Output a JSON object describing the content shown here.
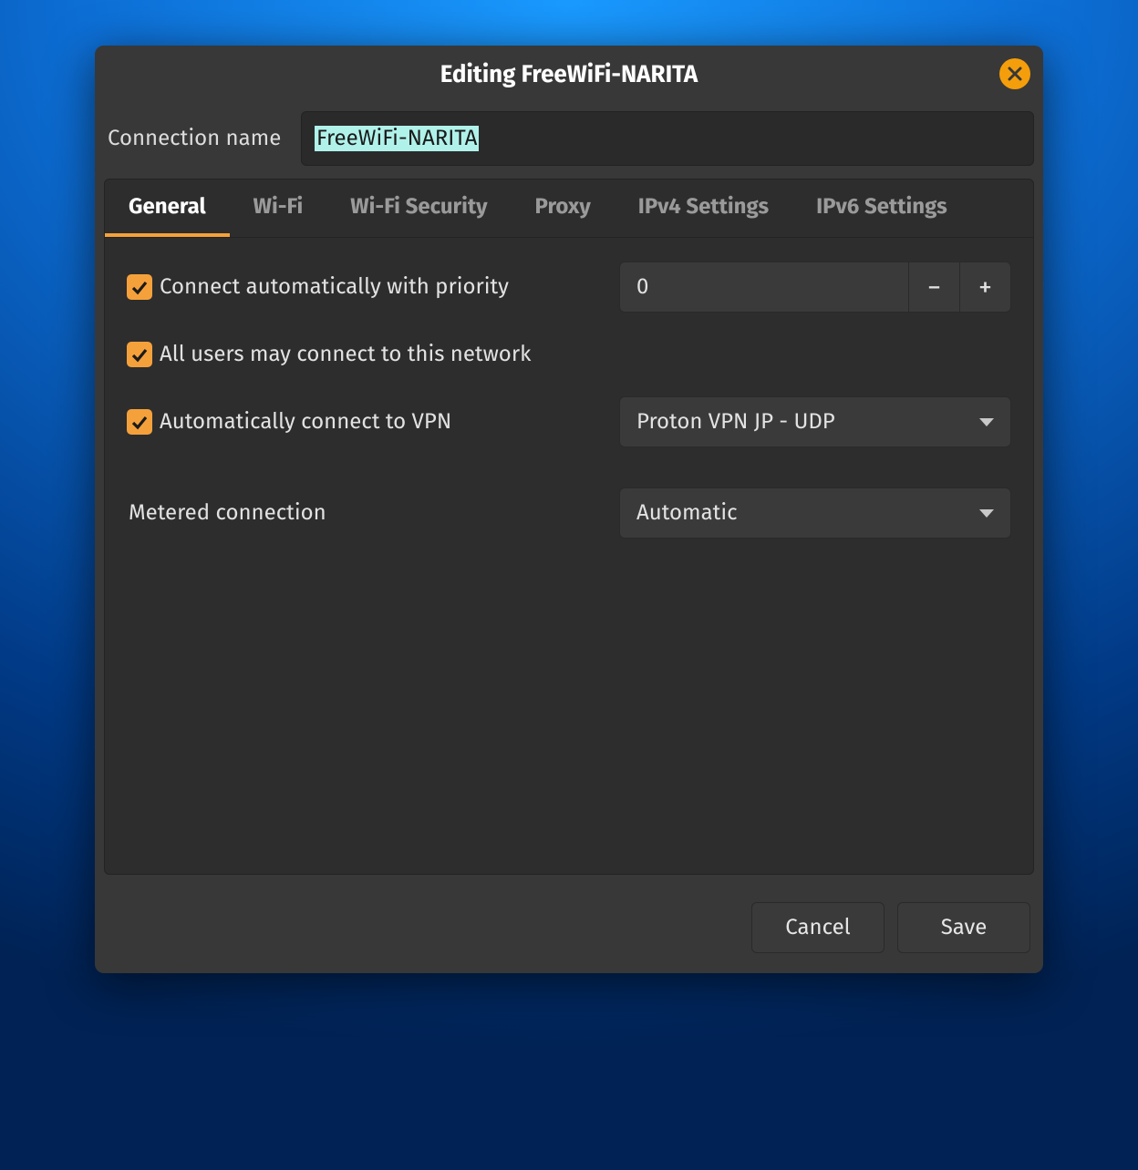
{
  "window": {
    "title": "Editing FreeWiFi-NARITA"
  },
  "connection_name": {
    "label": "Connection name",
    "value": "FreeWiFi-NARITA"
  },
  "tabs": [
    {
      "label": "General",
      "active": true
    },
    {
      "label": "Wi-Fi",
      "active": false
    },
    {
      "label": "Wi-Fi Security",
      "active": false
    },
    {
      "label": "Proxy",
      "active": false
    },
    {
      "label": "IPv4 Settings",
      "active": false
    },
    {
      "label": "IPv6 Settings",
      "active": false
    }
  ],
  "general": {
    "connect_automatically": {
      "label": "Connect automatically with priority",
      "checked": true,
      "priority_value": "0"
    },
    "all_users": {
      "label": "All users may connect to this network",
      "checked": true
    },
    "auto_vpn": {
      "label": "Automatically connect to VPN",
      "checked": true,
      "selected": "Proton VPN JP - UDP"
    },
    "metered": {
      "label": "Metered connection",
      "selected": "Automatic"
    }
  },
  "footer": {
    "cancel": "Cancel",
    "save": "Save"
  },
  "glyphs": {
    "minus": "−",
    "plus": "+"
  }
}
